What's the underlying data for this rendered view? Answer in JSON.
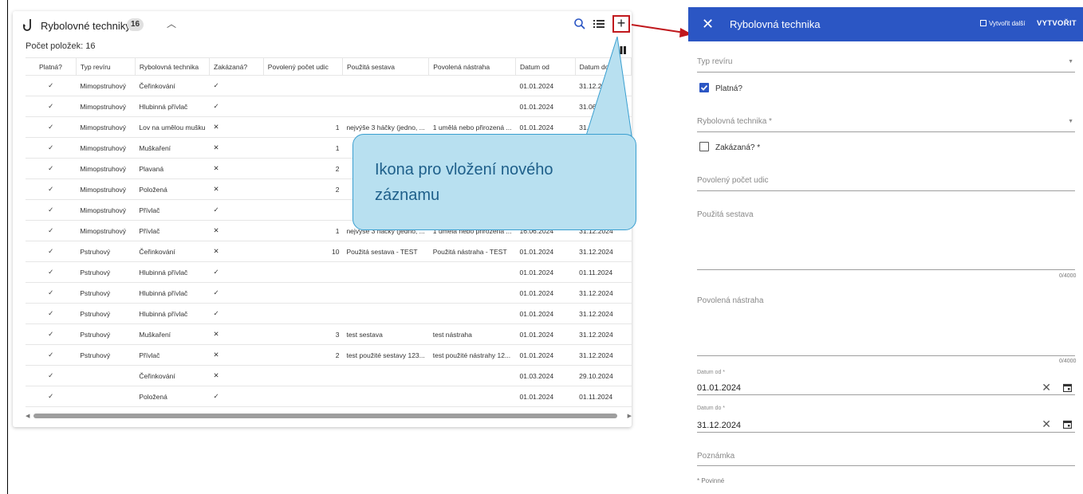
{
  "table": {
    "title": "Rybolovné techniky",
    "count_badge": "16",
    "item_count": "Počet položek: 16",
    "columns": [
      "Platná?",
      "Typ revíru",
      "Rybolovná technika",
      "Zakázaná?",
      "Povolený počet udic",
      "Použitá sestava",
      "Povolená nástraha",
      "Datum od",
      "Datum do"
    ],
    "rows": [
      [
        "✓",
        "Mimopstruhový",
        "Čeřinkování",
        "✓",
        "",
        "",
        "",
        "01.01.2024",
        "31.12.2024"
      ],
      [
        "✓",
        "Mimopstruhový",
        "Hlubinná přívlač",
        "✓",
        "",
        "",
        "",
        "01.01.2024",
        "31.06.2024"
      ],
      [
        "✓",
        "Mimopstruhový",
        "Lov na umělou mušku",
        "✕",
        "1",
        "nejvýše 3 háčky (jedno, ...",
        "1 umělá nebo přirozená ...",
        "01.01.2024",
        "31.12.2024"
      ],
      [
        "✓",
        "Mimopstruhový",
        "Muškaření",
        "✕",
        "1",
        "",
        "",
        "",
        ""
      ],
      [
        "✓",
        "Mimopstruhový",
        "Plavaná",
        "✕",
        "2",
        "",
        "",
        "",
        ""
      ],
      [
        "✓",
        "Mimopstruhový",
        "Položená",
        "✕",
        "2",
        "",
        "",
        "",
        ""
      ],
      [
        "✓",
        "Mimopstruhový",
        "Přívlač",
        "✓",
        "",
        "",
        "",
        "",
        ""
      ],
      [
        "✓",
        "Mimopstruhový",
        "Přívlač",
        "✕",
        "1",
        "nejvýše 3 háčky (jedno, ...",
        "1 umělá nebo přirozená ...",
        "16.06.2024",
        "31.12.2024"
      ],
      [
        "✓",
        "Pstruhový",
        "Čeřinkování",
        "✕",
        "10",
        "Použitá sestava - TEST",
        "Použitá nástraha - TEST",
        "01.01.2024",
        "31.12.2024"
      ],
      [
        "✓",
        "Pstruhový",
        "Hlubinná přívlač",
        "✓",
        "",
        "",
        "",
        "01.01.2024",
        "01.11.2024"
      ],
      [
        "✓",
        "Pstruhový",
        "Hlubinná přívlač",
        "✓",
        "",
        "",
        "",
        "01.01.2024",
        "31.12.2024"
      ],
      [
        "✓",
        "Pstruhový",
        "Hlubinná přívlač",
        "✓",
        "",
        "",
        "",
        "01.01.2024",
        "31.12.2024"
      ],
      [
        "✓",
        "Pstruhový",
        "Muškaření",
        "✕",
        "3",
        "test sestava",
        "test nástraha",
        "01.01.2024",
        "31.12.2024"
      ],
      [
        "✓",
        "Pstruhový",
        "Přívlač",
        "✕",
        "2",
        "test použité sestavy 123...",
        "test použité nástrahy 12...",
        "01.01.2024",
        "31.12.2024"
      ],
      [
        "✓",
        "",
        "Čeřinkování",
        "✕",
        "",
        "",
        "",
        "01.03.2024",
        "29.10.2024"
      ],
      [
        "✓",
        "",
        "Položená",
        "✓",
        "",
        "",
        "",
        "01.01.2024",
        "01.11.2024"
      ]
    ]
  },
  "callout": {
    "text": "Ikona pro vložení nového záznamu"
  },
  "panel": {
    "title": "Rybolovná technika",
    "create_another": "Vytvořit další",
    "create_button": "VYTVOŘIT",
    "fields": {
      "reviir_type": "Typ revíru",
      "valid": "Platná?",
      "technique": "Rybolovná technika *",
      "forbidden": "Zakázaná? *",
      "rod_count": "Povolený počet udic",
      "set": "Použitá sestava",
      "set_counter": "0/4000",
      "bait": "Povolená nástraha",
      "bait_counter": "0/4000",
      "date_from_label": "Datum od *",
      "date_from": "01.01.2024",
      "date_to_label": "Datum do *",
      "date_to": "31.12.2024",
      "note": "Poznámka"
    },
    "required_note": "* Povinné"
  },
  "colors": {
    "header_blue": "#2b56c4",
    "callout_fill": "#b8e0f0",
    "highlight_red": "#c0181d"
  }
}
